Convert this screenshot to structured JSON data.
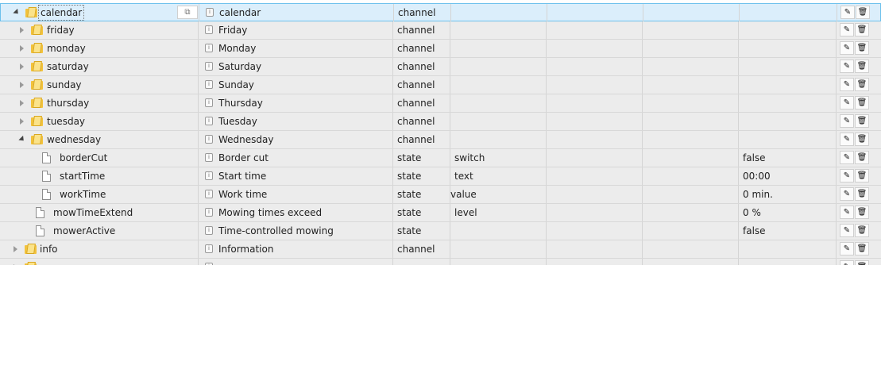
{
  "rows": [
    {
      "id": "calendar",
      "name": "calendar",
      "type": "channel",
      "role": "",
      "value": "",
      "level": 1,
      "kind": "folder",
      "toggle": "expanded",
      "selected": true
    },
    {
      "id": "friday",
      "name": "Friday",
      "type": "channel",
      "role": "",
      "value": "",
      "level": 2,
      "kind": "folder",
      "toggle": "collapsed"
    },
    {
      "id": "monday",
      "name": "Monday",
      "type": "channel",
      "role": "",
      "value": "",
      "level": 2,
      "kind": "folder",
      "toggle": "collapsed"
    },
    {
      "id": "saturday",
      "name": "Saturday",
      "type": "channel",
      "role": "",
      "value": "",
      "level": 2,
      "kind": "folder",
      "toggle": "collapsed"
    },
    {
      "id": "sunday",
      "name": "Sunday",
      "type": "channel",
      "role": "",
      "value": "",
      "level": 2,
      "kind": "folder",
      "toggle": "collapsed"
    },
    {
      "id": "thursday",
      "name": "Thursday",
      "type": "channel",
      "role": "",
      "value": "",
      "level": 2,
      "kind": "folder",
      "toggle": "collapsed"
    },
    {
      "id": "tuesday",
      "name": "Tuesday",
      "type": "channel",
      "role": "",
      "value": "",
      "level": 2,
      "kind": "folder",
      "toggle": "collapsed"
    },
    {
      "id": "wednesday",
      "name": "Wednesday",
      "type": "channel",
      "role": "",
      "value": "",
      "level": 2,
      "kind": "folder",
      "toggle": "expanded"
    },
    {
      "id": "borderCut",
      "name": "Border cut",
      "type": "state",
      "role": "switch",
      "value": "false",
      "level": 3,
      "kind": "file"
    },
    {
      "id": "startTime",
      "name": "Start time",
      "type": "state",
      "role": "text",
      "value": "00:00",
      "level": 3,
      "kind": "file"
    },
    {
      "id": "workTime",
      "name": "Work time",
      "type": "state",
      "role": "value",
      "value": "0 min.",
      "level": 3,
      "kind": "file",
      "role_shift": true
    },
    {
      "id": "mowTimeExtend",
      "name": "Mowing times exceed",
      "type": "state",
      "role": "level",
      "value": "0 %",
      "level": 2,
      "kind": "file"
    },
    {
      "id": "mowerActive",
      "name": "Time-controlled mowing",
      "type": "state",
      "role": "",
      "value": "false",
      "level": 2,
      "kind": "file"
    },
    {
      "id": "info",
      "name": "Information",
      "type": "channel",
      "role": "",
      "value": "",
      "level": 1,
      "kind": "folder",
      "toggle": "collapsed"
    },
    {
      "id": "",
      "name": "",
      "type": "",
      "role": "",
      "value": "",
      "level": 1,
      "kind": "folder",
      "toggle": "collapsed",
      "partial": true
    }
  ],
  "icons": {
    "copy": "⧉",
    "edit": "✎",
    "delete": "🗑",
    "info": "i"
  }
}
